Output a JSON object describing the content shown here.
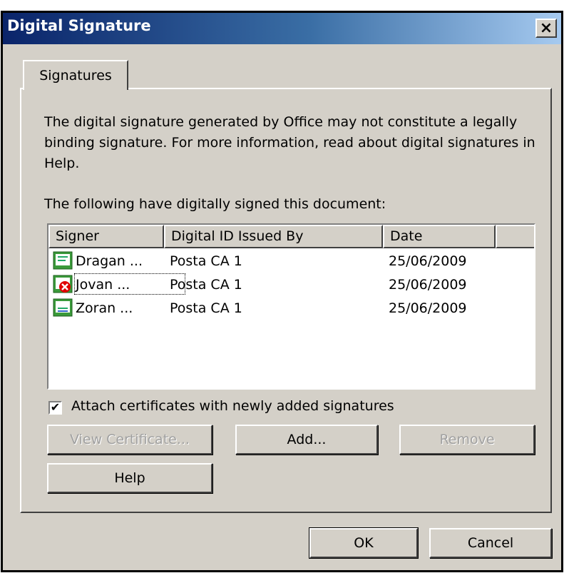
{
  "window": {
    "title": "Digital Signature",
    "close_label": "×"
  },
  "tabs": [
    {
      "label": "Signatures",
      "active": true
    }
  ],
  "info_text": "The digital signature generated by Office may not constitute a legally binding signature. For more information, read about digital signatures in Help.",
  "list_label": "The following have digitally signed this document:",
  "table": {
    "columns": [
      "Signer",
      "Digital ID Issued By",
      "Date",
      ""
    ],
    "rows": [
      {
        "signer": "Dragan ...",
        "issuer": "Posta CA 1",
        "date": "25/06/2009",
        "icon": "certificate-valid-icon"
      },
      {
        "signer": "Jovan ...",
        "issuer": "Posta CA 1",
        "date": "25/06/2009",
        "icon": "certificate-invalid-icon"
      },
      {
        "signer": "Zoran ...",
        "issuer": "Posta CA 1",
        "date": "25/06/2009",
        "icon": "certificate-icon"
      }
    ]
  },
  "attach_checkbox": {
    "label": "Attach certificates with newly added signatures",
    "checked": true,
    "mark": "✔"
  },
  "buttons": {
    "view_certificate": "View Certificate...",
    "add": "Add...",
    "remove": "Remove",
    "help": "Help",
    "ok": "OK",
    "cancel": "Cancel"
  },
  "colors": {
    "title_start": "#0a246a",
    "title_end": "#a6caf0",
    "dialog_bg": "#d4d0c8",
    "callout": "#e00000"
  }
}
